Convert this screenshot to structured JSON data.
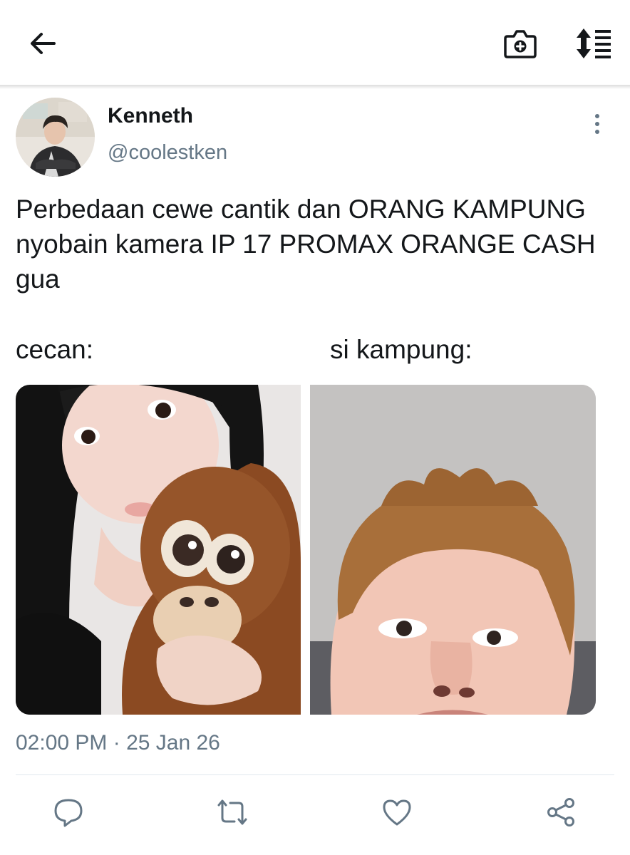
{
  "header": {
    "back_icon": "arrow-left-icon",
    "camera_icon": "camera-plus-icon",
    "sort_icon": "sort-list-icon"
  },
  "tweet": {
    "author_name": "Kenneth",
    "author_handle": "@coolestken",
    "text": "Perbedaan cewe cantik dan ORANG KAMPUNG nyobain kamera IP 17 PROMAX ORANGE CASH gua",
    "caption_left": "cecan:",
    "caption_right": "si kampung:",
    "timestamp": "02:00 PM · 25 Jan 26"
  },
  "actions": {
    "reply_icon": "reply-icon",
    "retweet_icon": "retweet-icon",
    "like_icon": "heart-icon",
    "share_icon": "share-icon"
  },
  "colors": {
    "text": "#14171a",
    "muted": "#657786",
    "divider": "#e1e8ed"
  }
}
